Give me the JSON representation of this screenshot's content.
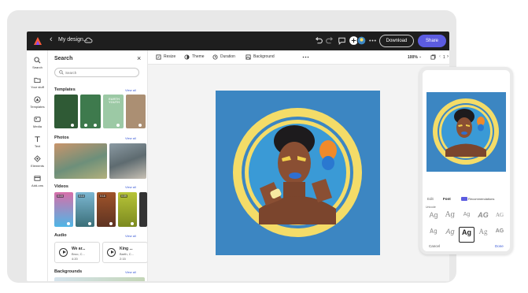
{
  "topbar": {
    "doc_title": "My design...",
    "download_label": "Download",
    "share_label": "Share"
  },
  "rail": {
    "items": [
      {
        "label": "Search",
        "icon": "search-icon"
      },
      {
        "label": "Your stuff",
        "icon": "folder-icon"
      },
      {
        "label": "Templates",
        "icon": "templates-icon"
      },
      {
        "label": "Media",
        "icon": "media-icon"
      },
      {
        "label": "Text",
        "icon": "text-icon"
      },
      {
        "label": "Elements",
        "icon": "elements-icon"
      },
      {
        "label": "Add-ons",
        "icon": "add-ons-icon"
      }
    ]
  },
  "panel": {
    "title": "Search",
    "search_placeholder": "Search",
    "templates": {
      "heading": "Templates",
      "view_all": "View all",
      "card_text_1": "EARTH YOUTH"
    },
    "photos": {
      "heading": "Photos",
      "view_all": "View all"
    },
    "videos": {
      "heading": "Videos",
      "view_all": "View all",
      "durations": [
        "0:15",
        "0:14",
        "0:16",
        "0:09"
      ]
    },
    "audio": {
      "heading": "Audio",
      "view_all": "View all",
      "tracks": [
        {
          "title": "We ar...",
          "artist": "Broo, C...",
          "duration": "4:20"
        },
        {
          "title": "King ...",
          "artist": "Barth, C...",
          "duration": "2:15"
        }
      ]
    },
    "backgrounds": {
      "heading": "Backgrounds",
      "view_all": "View all"
    }
  },
  "canvas_toolbar": {
    "resize": "Resize",
    "theme": "Theme",
    "duration": "Duration",
    "background": "Background",
    "zoom": "100%",
    "page_number": "1"
  },
  "phone": {
    "tabs": [
      "Edit",
      "Font"
    ],
    "recommendations": "Recommendations",
    "section": "Unicode",
    "fonts": [
      "Ag",
      "Ag",
      "Ag",
      "AG",
      "AG",
      "Ag",
      "Ag",
      "Ag",
      "Ag",
      "AG"
    ],
    "selected_font_index": 7,
    "cancel": "Cancel",
    "done": "Done"
  },
  "colors": {
    "topbar": "#1e1e1e",
    "accent": "#5c5ce0",
    "artwork_background": "#3c86c2",
    "ring_yellow": "#f4dc68",
    "link_blue": "#3a5ad6"
  }
}
